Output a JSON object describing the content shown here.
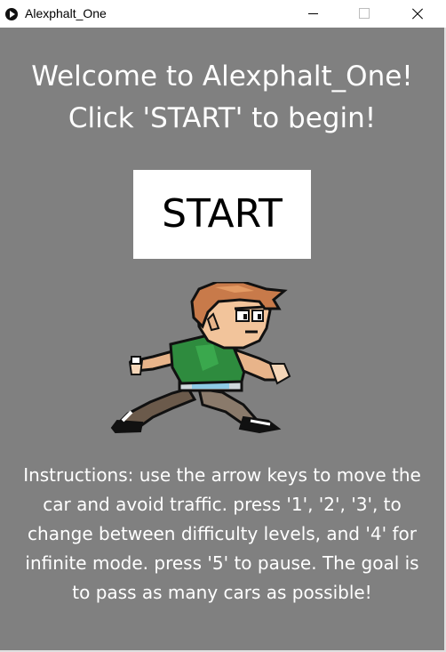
{
  "window": {
    "title": "Alexphalt_One"
  },
  "screen": {
    "welcome_line1": "Welcome to Alexphalt_One!",
    "welcome_line2": "Click 'START' to begin!",
    "start_label": "START",
    "instructions": "Instructions: use the arrow keys to move the car and avoid traffic. press '1', '2', '3', to change between difficulty levels, and '4' for infinite mode. press '5' to pause. The goal is to pass as many cars as possible!"
  },
  "colors": {
    "background": "#808080",
    "text": "#ffffff",
    "button": "#ffffff",
    "button_text": "#000000"
  },
  "icons": {
    "app": "processing-app-icon",
    "character": "running-pixel-character"
  }
}
